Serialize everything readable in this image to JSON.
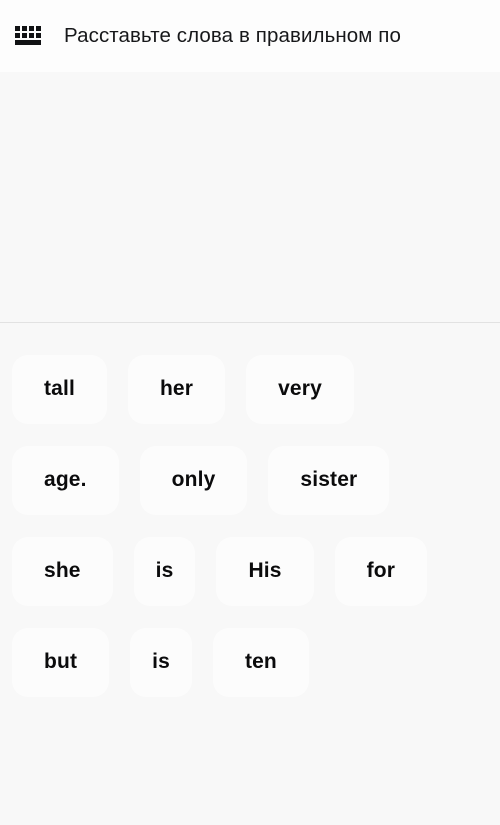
{
  "header": {
    "icon": "keyboard-icon",
    "title": "Расставьте слова в правильном по",
    "title_full_visible": "Расставьте слова в правильном по",
    "background": "#fdfdfd",
    "text_color": "#17181a"
  },
  "answer_zone": {
    "placeholder_text": "",
    "slots": [],
    "background": "#f8f8f8"
  },
  "divider": {
    "color": "#e2e2e2"
  },
  "word_bank": {
    "background": "#f8f8f8",
    "chip_background": "#fcfcfc",
    "chip_text_color": "#0b0b0c",
    "rows": [
      {
        "chips": [
          {
            "label": "tall",
            "size": "wide"
          },
          {
            "label": "her",
            "size": "wide"
          },
          {
            "label": "very",
            "size": "wide"
          }
        ]
      },
      {
        "chips": [
          {
            "label": "age.",
            "size": "wide"
          },
          {
            "label": "only",
            "size": "wide"
          },
          {
            "label": "sister",
            "size": "wide"
          }
        ]
      },
      {
        "chips": [
          {
            "label": "she",
            "size": "wide"
          },
          {
            "label": "is",
            "size": "narrow"
          },
          {
            "label": "His",
            "size": "wide"
          },
          {
            "label": "for",
            "size": "wide",
            "clipped": true
          }
        ]
      },
      {
        "chips": [
          {
            "label": "but",
            "size": "wide"
          },
          {
            "label": "is",
            "size": "narrow"
          },
          {
            "label": "ten",
            "size": "wide"
          }
        ]
      }
    ]
  }
}
